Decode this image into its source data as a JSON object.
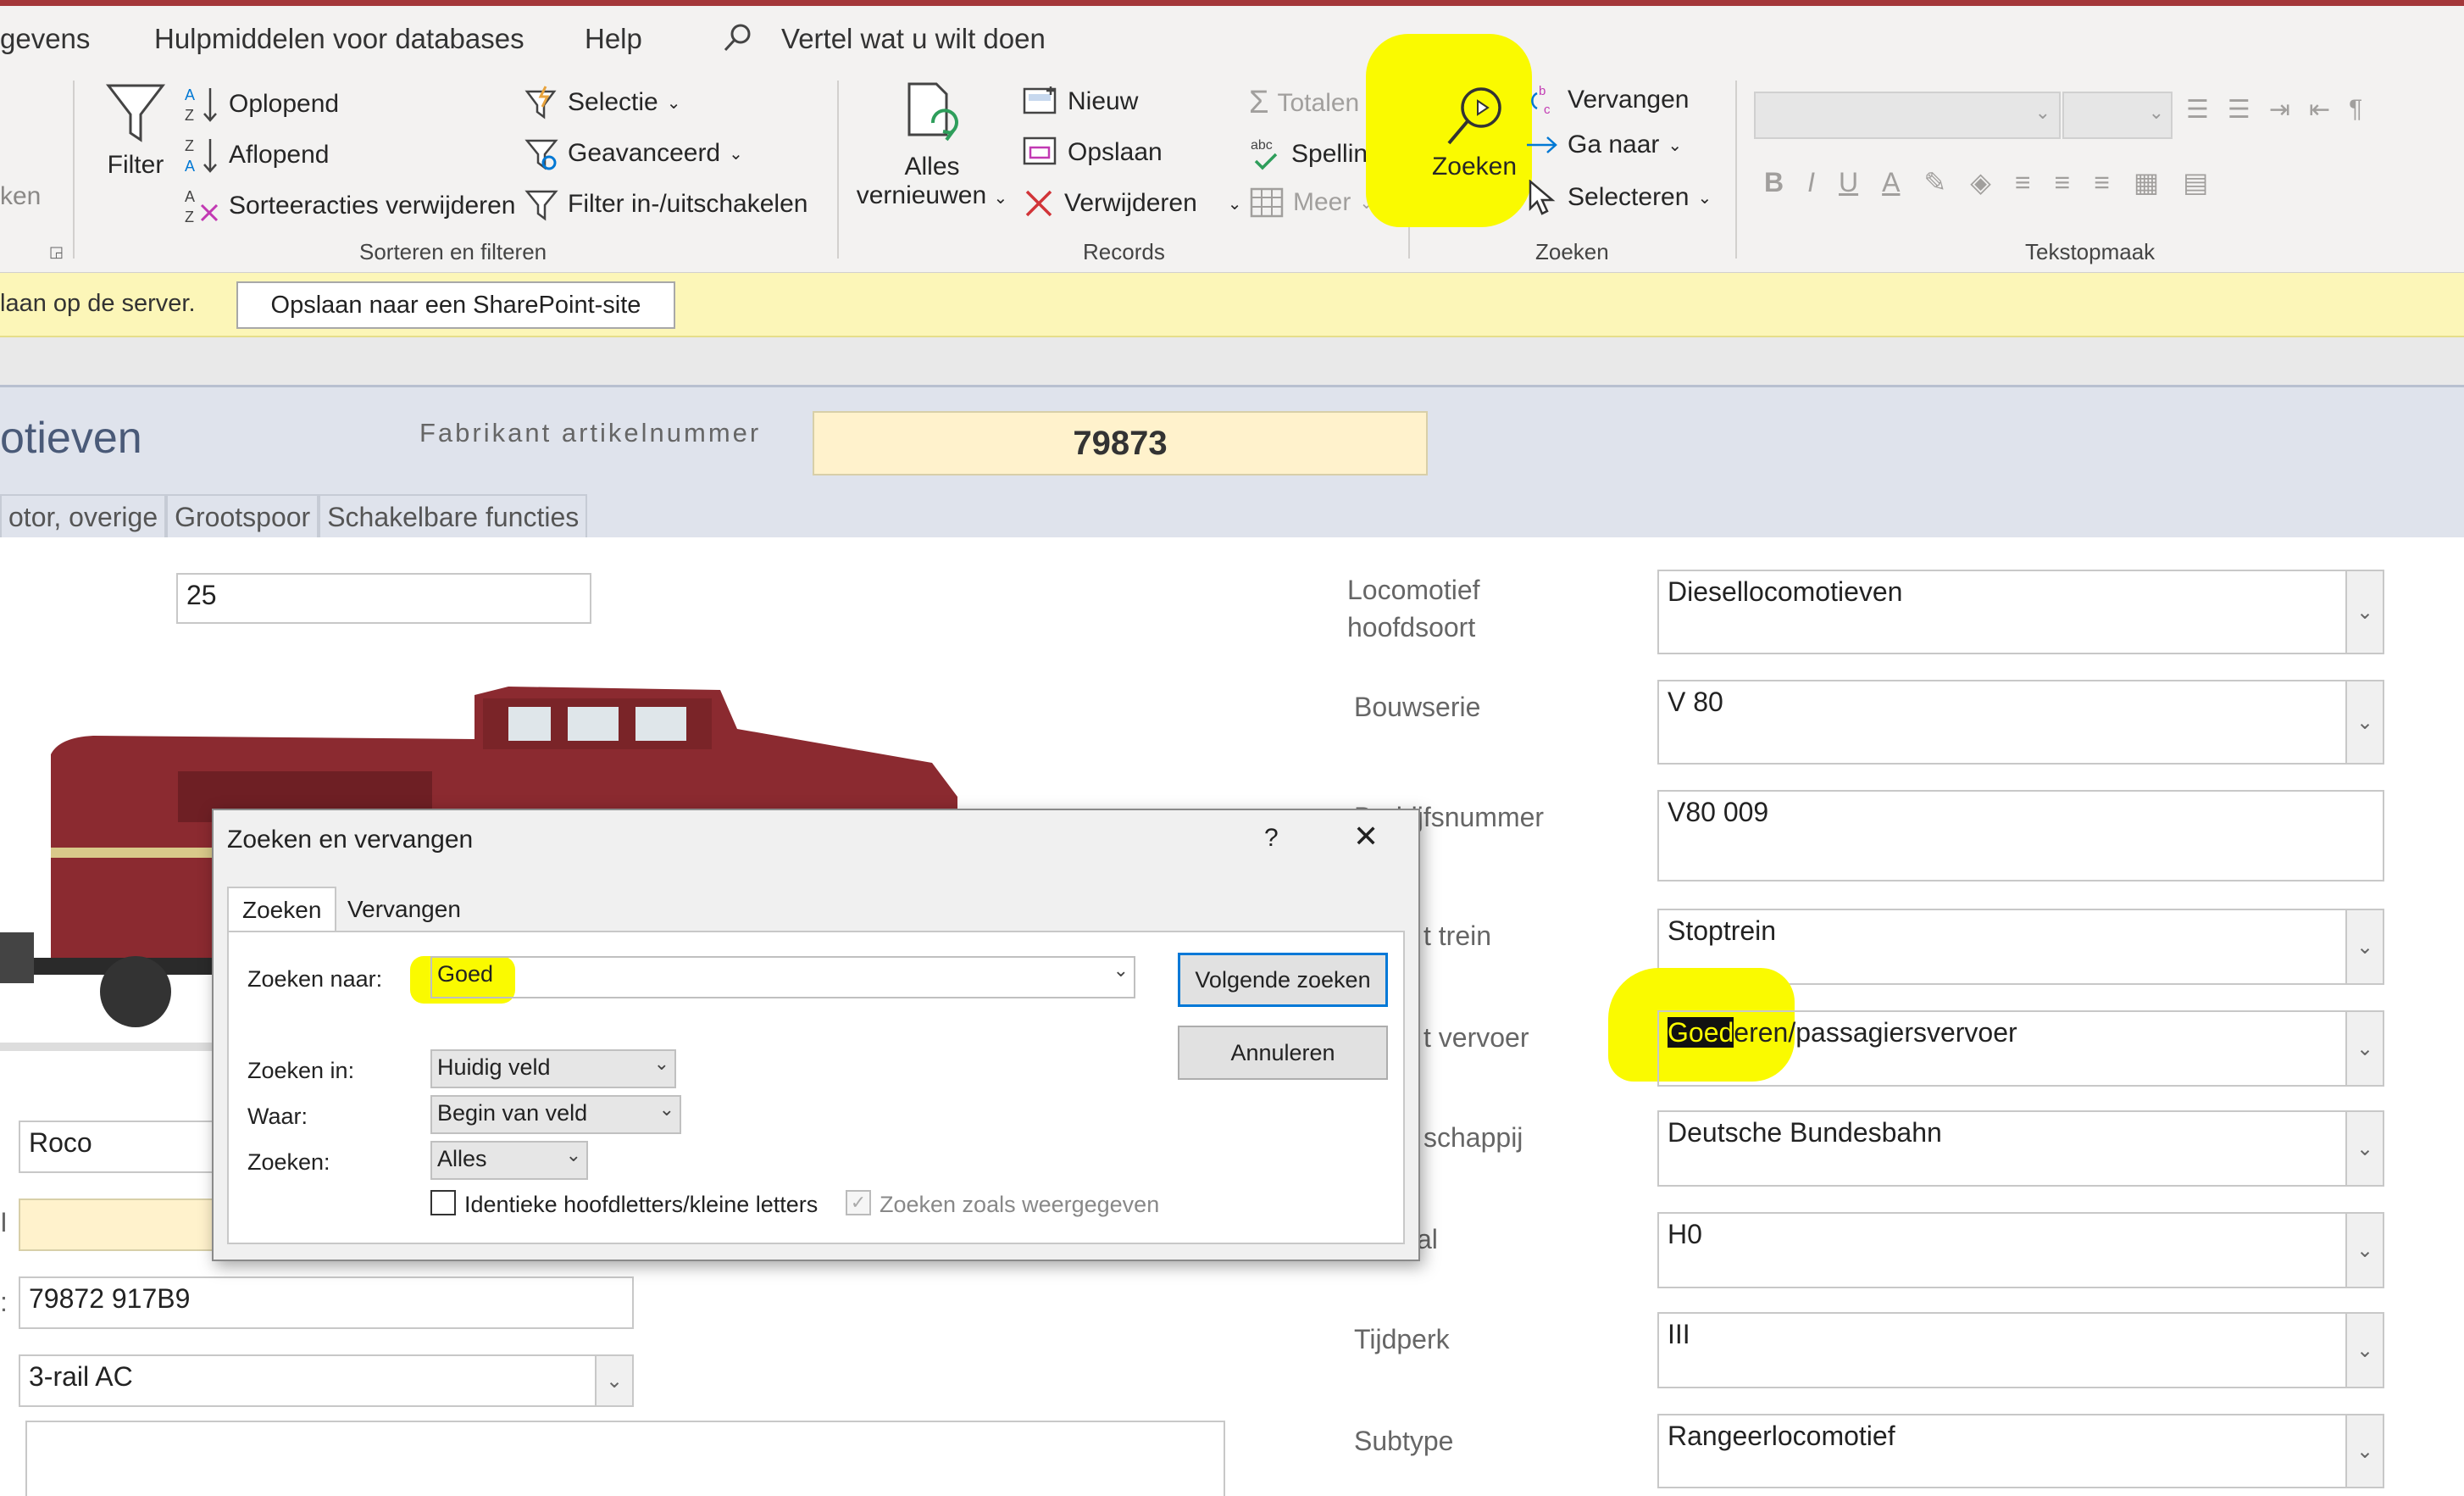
{
  "menu": {
    "tab_gegevens": "gevens",
    "tab_hulpmiddelen": "Hulpmiddelen voor databases",
    "tab_help": "Help",
    "tell_me": "Vertel wat u wilt doen"
  },
  "ribbon": {
    "cut_text": "ken",
    "filter": "Filter",
    "oplopend": "Oplopend",
    "aflopend": "Aflopend",
    "sorteeracties": "Sorteeracties verwijderen",
    "selectie": "Selectie",
    "geavanceerd": "Geavanceerd",
    "filter_toggle": "Filter in-/uitschakelen",
    "group_sort": "Sorteren en filteren",
    "alles_1": "Alles",
    "alles_2": "vernieuwen",
    "nieuw": "Nieuw",
    "opslaan": "Opslaan",
    "verwijderen": "Verwijderen",
    "totalen": "Totalen",
    "spelling": "Spelling",
    "meer": "Meer",
    "group_records": "Records",
    "zoeken": "Zoeken",
    "vervangen": "Vervangen",
    "ga_naar": "Ga naar",
    "selecteren": "Selecteren",
    "group_zoeken": "Zoeken",
    "group_tekst": "Tekstopmaak"
  },
  "infobar": {
    "text": "laan op de server.",
    "button": "Opslaan naar een SharePoint-site"
  },
  "form": {
    "title": "otieven",
    "fab_label": "Fabrikant artikelnummer",
    "fab_value": "79873",
    "tabs": [
      "otor, overige",
      "Grootspoor",
      "Schakelbare functies"
    ],
    "left": {
      "field_top": "25",
      "manufacturer": "Roco",
      "article": "79872 917B9",
      "system": "3-rail AC",
      "stub_i": "I",
      "stub_colon": ":"
    },
    "right": {
      "loc_label_1": "Locomotief",
      "loc_label_2": "hoofdsoort",
      "loc_value": "Diesellocomotieven",
      "bouw_label": "Bouwserie",
      "bouw_value": "V 80",
      "bedrijf_label": "Bedrijfsnummer",
      "bedrijf_value": "V80 009",
      "trein_label": "t trein",
      "trein_value": "Stoptrein",
      "vervoer_label": "t vervoer",
      "vervoer_value_sel": "Goed",
      "vervoer_value_rest": "eren/passagiersvervoer",
      "maatschappij_label": "schappij",
      "maatschappij_value": "Deutsche Bundesbahn",
      "spoor_label": "al",
      "spoor_value": "H0",
      "tijdperk_label": "Tijdperk",
      "tijdperk_value": "III",
      "subtype_label": "Subtype",
      "subtype_value": "Rangeerlocomotief"
    }
  },
  "dialog": {
    "title": "Zoeken en vervangen",
    "help": "?",
    "close": "✕",
    "tab_zoeken": "Zoeken",
    "tab_vervangen": "Vervangen",
    "zoeken_naar_label": "Zoeken naar:",
    "zoeken_naar_value": "Goed",
    "zoeken_in_label": "Zoeken in:",
    "zoeken_in_value": "Huidig veld",
    "waar_label": "Waar:",
    "waar_value": "Begin van veld",
    "zoeken_label": "Zoeken:",
    "zoeken_value": "Alles",
    "match_case": "Identieke hoofdletters/kleine letters",
    "search_formatted": "Zoeken zoals weergegeven",
    "btn_next": "Volgende zoeken",
    "btn_cancel": "Annuleren"
  },
  "colors": {
    "highlight": "#fafa00",
    "title_strip": "#a4373a",
    "infobar": "#fcf6b8",
    "form_header": "#dfe3ec",
    "input_yellow": "#fff2cc"
  }
}
